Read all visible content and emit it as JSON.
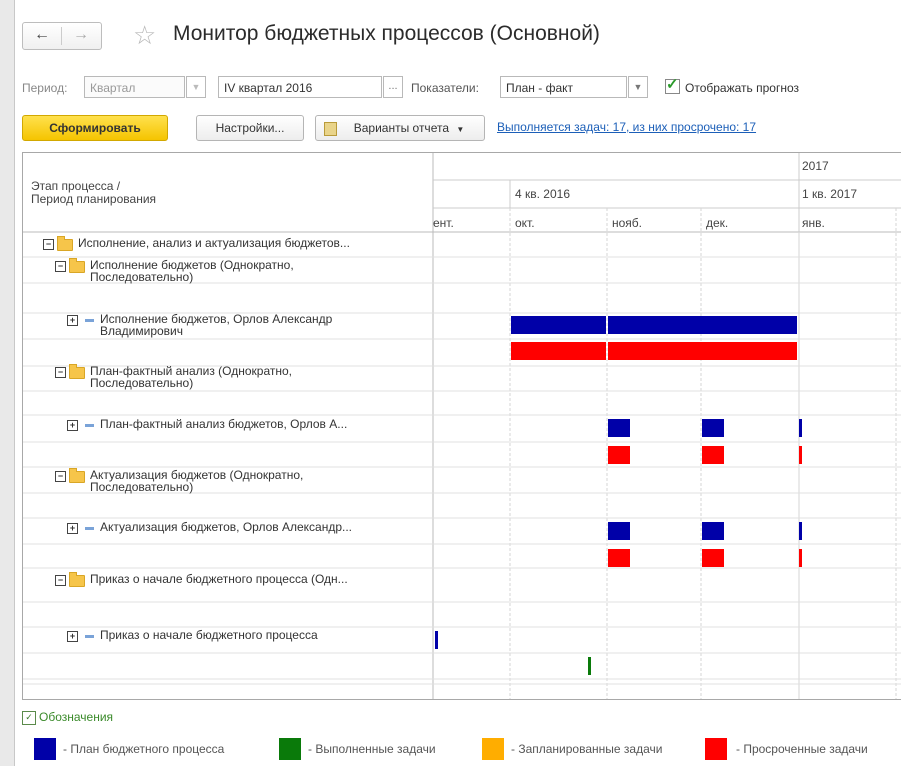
{
  "header": {
    "title": "Монитор бюджетных процессов (Основной)",
    "back_icon": "←",
    "forward_icon": "→",
    "favorite_icon": "☆"
  },
  "filters": {
    "period_label": "Период:",
    "period_type": "Квартал",
    "period_value": "IV квартал 2016",
    "period_btn": "...",
    "indicators_label": "Показатели:",
    "indicators_value": "План - факт",
    "show_forecast_label": "Отображать прогноз"
  },
  "toolbar": {
    "generate_label": "Сформировать",
    "settings_label": "Настройки...",
    "variants_label": "Варианты отчета",
    "tasks_link": "Выполняется задач: 17, из них просрочено: 17"
  },
  "grid": {
    "header_left": "Этап процесса /\nПериод планирования",
    "year": "2017",
    "quarters": [
      "4 кв. 2016",
      "1 кв. 2017"
    ],
    "months": [
      "ент.",
      "окт.",
      "нояб.",
      "дек.",
      "янв."
    ],
    "rows": [
      {
        "level": 0,
        "type": "folder",
        "text": "Исполнение, анализ и актуализация бюджетов..."
      },
      {
        "level": 1,
        "type": "folder",
        "text": "Исполнение бюджетов (Однократно,\nПоследовательно)"
      },
      {
        "level": 2,
        "type": "task",
        "text": "Исполнение бюджетов, Орлов Александр\nВладимирович"
      },
      {
        "level": 1,
        "type": "folder",
        "text": "План-фактный анализ (Однократно,\nПоследовательно)"
      },
      {
        "level": 2,
        "type": "task",
        "text": "План-фактный анализ бюджетов, Орлов А..."
      },
      {
        "level": 1,
        "type": "folder",
        "text": "Актуализация бюджетов (Однократно,\nПоследовательно)"
      },
      {
        "level": 2,
        "type": "task",
        "text": "Актуализация бюджетов, Орлов Александр..."
      },
      {
        "level": 1,
        "type": "folder",
        "text": "Приказ о начале бюджетного процесса (Одн..."
      },
      {
        "level": 2,
        "type": "task",
        "text": "Приказ о начале бюджетного процесса"
      }
    ]
  },
  "legend": {
    "title": "Обозначения",
    "items": [
      {
        "label": "- План бюджетного процесса",
        "color": "#0000a8"
      },
      {
        "label": "- Выполненные задачи",
        "color": "#0a7a0a"
      },
      {
        "label": "- Запланированные задачи",
        "color": "#ffad00"
      },
      {
        "label": "- Просроченные задачи",
        "color": "#ff0000"
      }
    ]
  },
  "colors": {
    "plan": "#0000a8",
    "done": "#0a7a0a",
    "planned": "#ffad00",
    "overdue": "#ff0000",
    "accent": "#f5c400"
  }
}
